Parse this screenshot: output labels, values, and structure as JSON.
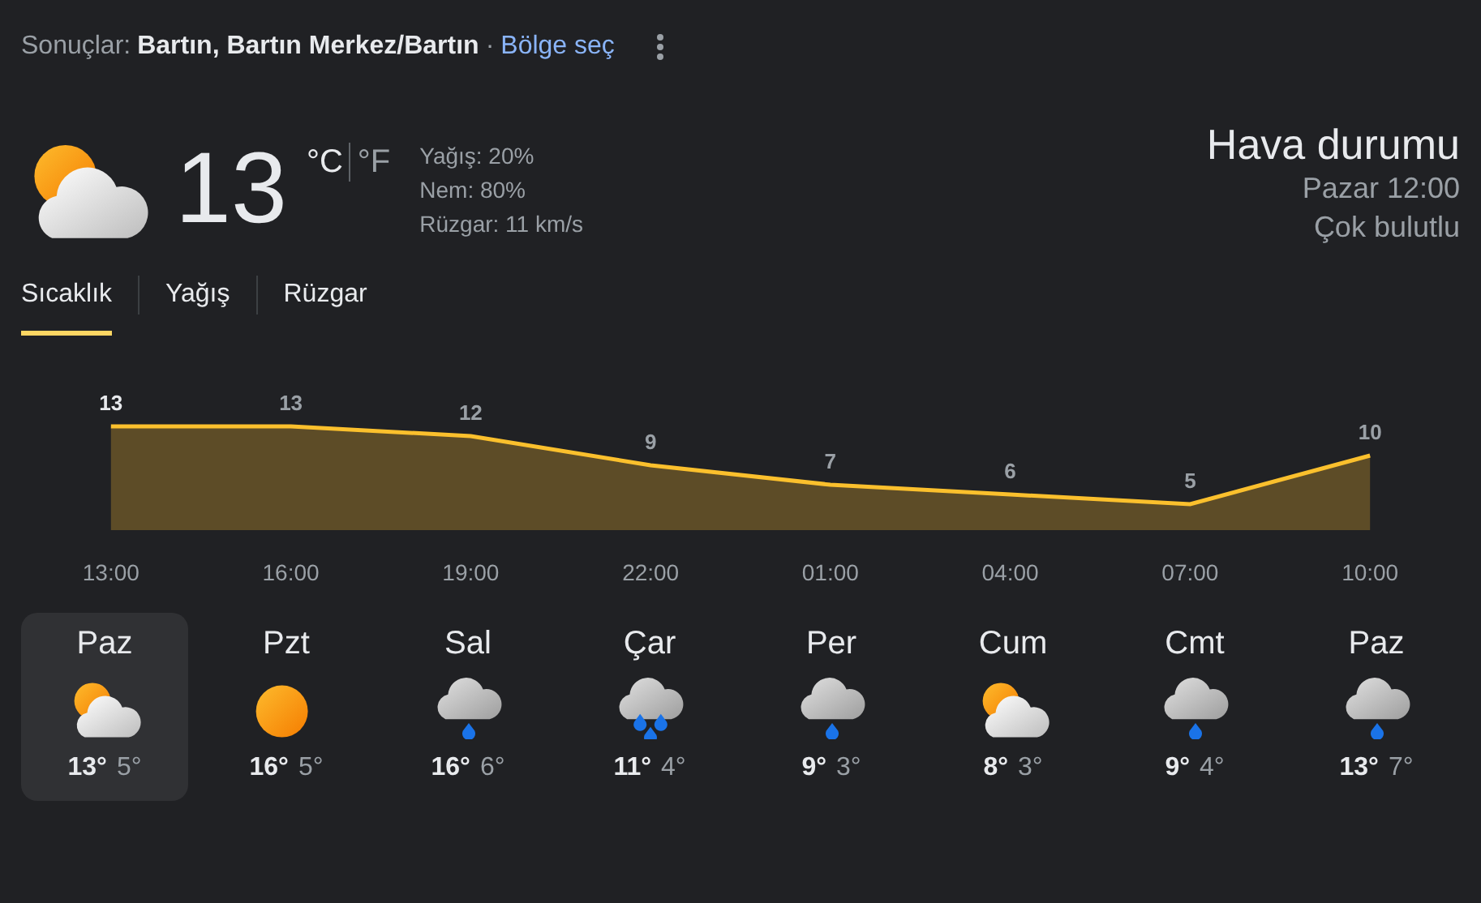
{
  "header": {
    "prefix": "Sonuçlar:",
    "location": "Bartın, Bartın Merkez/Bartın",
    "separator": "·",
    "link": "Bölge seç"
  },
  "current": {
    "kind": "partly_cloudy",
    "temperature": "13",
    "units": [
      {
        "label": "°C",
        "selected": true
      },
      {
        "label": "°F",
        "selected": false
      }
    ],
    "details": [
      "Yağış: 20%",
      "Nem: 80%",
      "Rüzgar: 11 km/s"
    ],
    "title": "Hava durumu",
    "time": "Pazar 12:00",
    "condition": "Çok bulutlu"
  },
  "tabs": [
    {
      "label": "Sıcaklık",
      "selected": true
    },
    {
      "label": "Yağış",
      "selected": false
    },
    {
      "label": "Rüzgar",
      "selected": false
    }
  ],
  "chart_data": {
    "type": "area",
    "categories": [
      "13:00",
      "16:00",
      "19:00",
      "22:00",
      "01:00",
      "04:00",
      "07:00",
      "10:00"
    ],
    "series": [
      {
        "color": "#fbc02d",
        "values": [
          13,
          13,
          12,
          9,
          7,
          6,
          5,
          10
        ]
      }
    ],
    "data_labels": true
  },
  "days": [
    {
      "day": "Paz",
      "kind": "partly_cloudy",
      "high": "13°",
      "low": "5°",
      "selected": true
    },
    {
      "day": "Pzt",
      "kind": "sunny",
      "high": "16°",
      "low": "5°",
      "selected": false
    },
    {
      "day": "Sal",
      "kind": "rain",
      "high": "16°",
      "low": "6°",
      "selected": false
    },
    {
      "day": "Çar",
      "kind": "heavy_rain",
      "high": "11°",
      "low": "4°",
      "selected": false
    },
    {
      "day": "Per",
      "kind": "rain",
      "high": "9°",
      "low": "3°",
      "selected": false
    },
    {
      "day": "Cum",
      "kind": "partly_cloudy",
      "high": "8°",
      "low": "3°",
      "selected": false
    },
    {
      "day": "Cmt",
      "kind": "rain",
      "high": "9°",
      "low": "4°",
      "selected": false
    },
    {
      "day": "Paz",
      "kind": "rain",
      "high": "13°",
      "low": "7°",
      "selected": false
    }
  ]
}
